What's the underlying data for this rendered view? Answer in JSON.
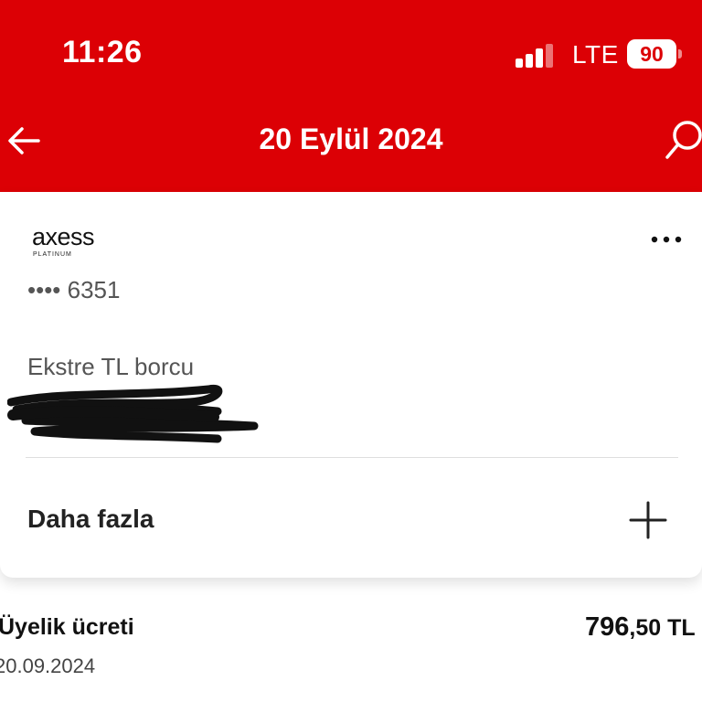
{
  "status_bar": {
    "time": "11:26",
    "network": "LTE",
    "battery": "90",
    "signal_bars": 4,
    "signal_bars_active": 3
  },
  "header": {
    "title": "20 Eylül 2024",
    "back_icon": "arrow-left-icon",
    "search_icon": "search-icon",
    "color": "#dc0005"
  },
  "card": {
    "brand": "axess",
    "tier": "PLATINUM",
    "number": "•••• 6351",
    "menu_icon": "more-horizontal-icon",
    "statement_label": "Ekstre TL borcu",
    "more_label": "Daha fazla",
    "expand_icon": "plus-icon"
  },
  "transactions": [
    {
      "name": "Üyelik ücreti",
      "date": "20.09.2024",
      "amount_int": "796",
      "amount_dec": ",50 TL"
    }
  ]
}
